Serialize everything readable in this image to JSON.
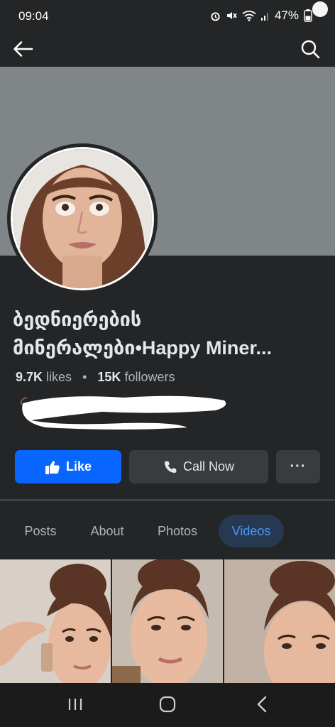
{
  "status_bar": {
    "time": "09:04",
    "battery": "47%",
    "icons": [
      "alarm-icon",
      "mute-icon",
      "wifi-icon",
      "signal-icon",
      "battery-icon"
    ]
  },
  "header": {
    "back_icon": "arrow-left-icon",
    "search_icon": "search-icon"
  },
  "profile": {
    "name_line1": "ბედნიერების",
    "name_line2": "მინერალები•Happy Miner...",
    "likes_count": "9.7K",
    "likes_label": "likes",
    "separator": "•",
    "followers_count": "15K",
    "followers_label": "followers"
  },
  "actions": {
    "like_label": "Like",
    "call_label": "Call Now",
    "more_label": "···"
  },
  "tabs": [
    {
      "label": "Posts",
      "active": false
    },
    {
      "label": "About",
      "active": false
    },
    {
      "label": "Photos",
      "active": false
    },
    {
      "label": "Videos",
      "active": true
    }
  ],
  "colors": {
    "background": "#242526",
    "cover": "#808588",
    "like_button": "#0866ff",
    "active_tab_bg": "#263951",
    "active_tab_text": "#4599ff"
  }
}
